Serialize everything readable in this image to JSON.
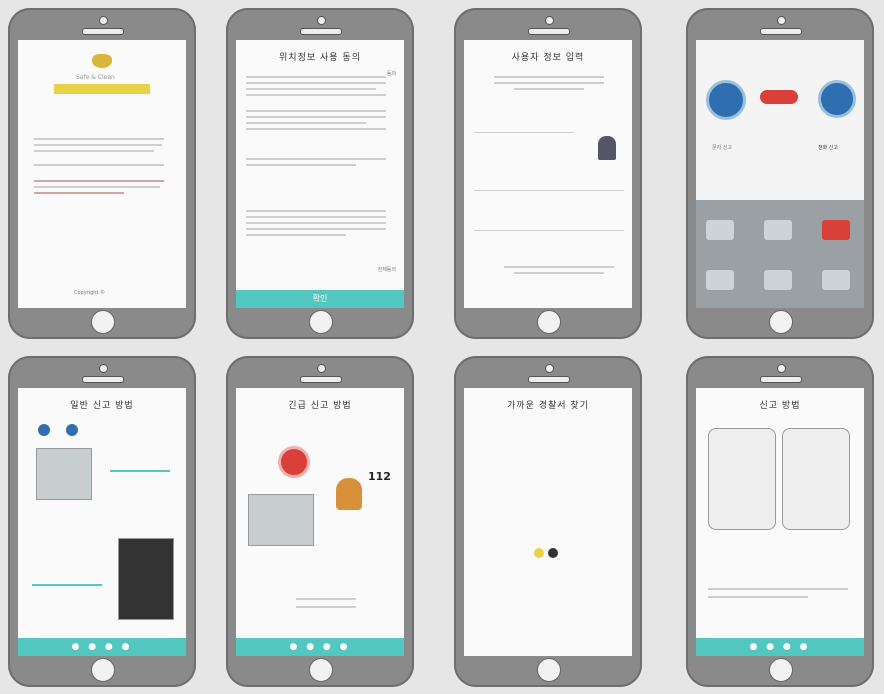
{
  "screens": {
    "s1": {
      "badge": "Safe & Clean",
      "footer": "Copyright ©"
    },
    "s2": {
      "title": "위치정보 사용 동의",
      "agree_label": "동의",
      "all_agree": "전체동의",
      "confirm": "확인"
    },
    "s3": {
      "title": "사용자 정보 입력"
    },
    "s4": {
      "label_left": "문자 신고",
      "label_right": "전화 신고"
    },
    "s5": {
      "title": "일반 신고 방법",
      "dots": "● ● ● ●"
    },
    "s6": {
      "title": "긴급 신고 방법",
      "number": "112",
      "dots": "● ● ● ●"
    },
    "s7": {
      "title": "가까운 경찰서 찾기"
    },
    "s8": {
      "title": "신고 방법",
      "dots": "● ● ● ●"
    }
  },
  "colors": {
    "teal": "#52c7bf",
    "gold": "#e8d24a",
    "red": "#d9403a",
    "blue": "#2f6fb0"
  }
}
